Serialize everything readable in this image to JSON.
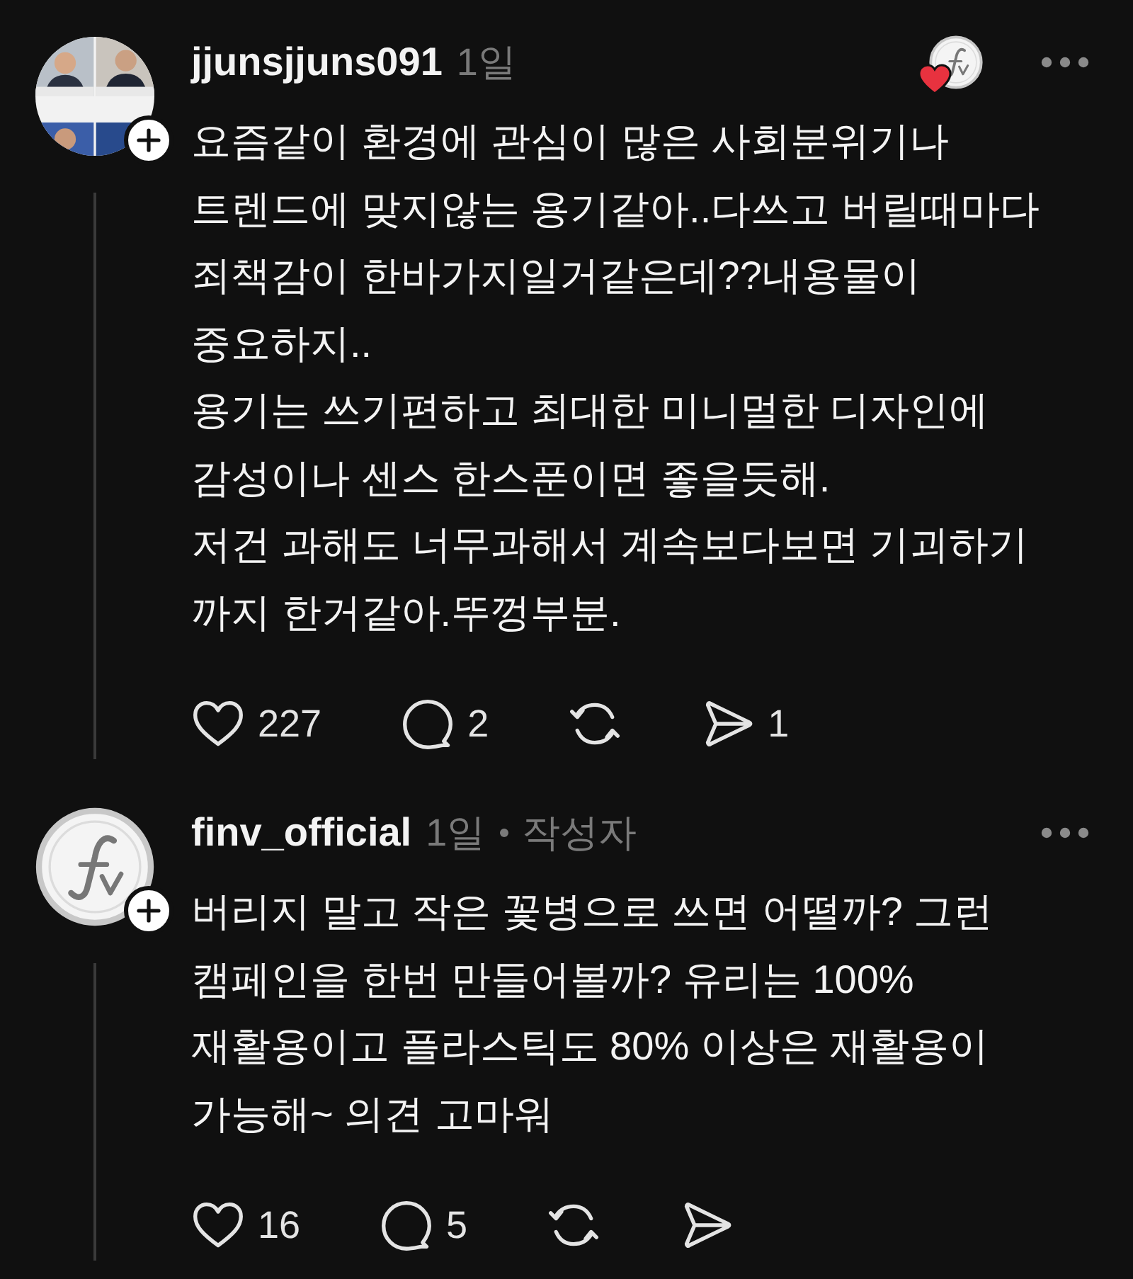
{
  "comments": [
    {
      "username": "jjunsjjuns091",
      "time": "1일",
      "can_follow": true,
      "liked_by_author": true,
      "thread_line": true,
      "body": "요즘같이 환경에 관심이 많은 사회분위기나\n트렌드에 맞지않는 용기같아..다쓰고 버릴때마다\n죄책감이 한바가지일거같은데??내용물이\n중요하지..\n용기는 쓰기편하고 최대한 미니멀한 디자인에\n감성이나 센스 한스푼이면 좋을듯해.\n저건 과해도 너무과해서 계속보다보면 기괴하기\n까지 한거같아.뚜껑부분.",
      "likes": "227",
      "replies": "2",
      "shares": "1"
    },
    {
      "username": "finv_official",
      "time": "1일",
      "role": "작성자",
      "avatar": {
        "kind": "logo"
      },
      "can_follow": true,
      "thread_line": true,
      "body": "버리지 말고 작은 꽃병으로 쓰면 어떨까? 그런\n캠페인을 한번 만들어볼까? 유리는 100%\n재활용이고 플라스틱도 80% 이상은 재활용이\n가능해~ 의견 고마워",
      "likes": "16",
      "replies": "5"
    }
  ]
}
